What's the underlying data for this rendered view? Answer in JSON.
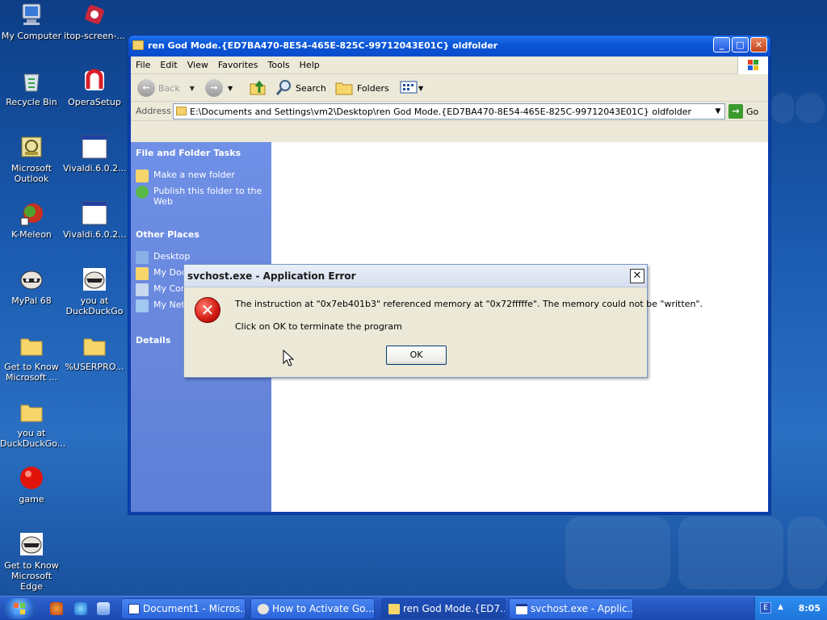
{
  "desktop": {
    "icons": [
      {
        "label": "My Computer",
        "icon": "my-computer-icon"
      },
      {
        "label": "itop-screen-...",
        "icon": "itop-app-icon"
      },
      {
        "label": "Recycle Bin",
        "icon": "recycle-bin-icon"
      },
      {
        "label": "OperaSetup",
        "icon": "opera-icon"
      },
      {
        "label": "Microsoft Outlook",
        "icon": "outlook-icon"
      },
      {
        "label": "Vivaldi.6.0.2...",
        "icon": "window-icon"
      },
      {
        "label": "K-Meleon",
        "icon": "k-meleon-icon"
      },
      {
        "label": "Vivaldi.6.0.2...",
        "icon": "window-icon"
      },
      {
        "label": "MyPal 68",
        "icon": "raccoon-icon"
      },
      {
        "label": "you at DuckDuckGo",
        "icon": "raccoon-icon"
      },
      {
        "label": "Get to Know Microsoft ...",
        "icon": "folder-icon"
      },
      {
        "label": "%USERPRO...",
        "icon": "folder-icon"
      },
      {
        "label": "you at DuckDuckGo...",
        "icon": "folder-icon"
      },
      {
        "label": "game",
        "icon": "red-ball-icon"
      },
      {
        "label": "Get to Know Microsoft Edge",
        "icon": "raccoon-icon"
      }
    ]
  },
  "explorer": {
    "title": "ren God Mode.{ED7BA470-8E54-465E-825C-99712043E01C} oldfolder",
    "menu": [
      "File",
      "Edit",
      "View",
      "Favorites",
      "Tools",
      "Help"
    ],
    "toolbar": {
      "back": "Back",
      "search": "Search",
      "folders": "Folders"
    },
    "address_label": "Address",
    "address_value": "E:\\Documents and Settings\\vm2\\Desktop\\ren God Mode.{ED7BA470-8E54-465E-825C-99712043E01C} oldfolder",
    "go_label": "Go",
    "tasks": {
      "heading": "File and Folder Tasks",
      "items": [
        "Make a new folder",
        "Publish this folder to the Web"
      ]
    },
    "other_places": {
      "heading": "Other Places",
      "items": [
        "Desktop",
        "My Documents",
        "My Computer",
        "My Network Places"
      ]
    },
    "details_heading": "Details"
  },
  "dialog": {
    "title": "svchost.exe - Application Error",
    "message": "The instruction at \"0x7eb401b3\" referenced memory at \"0x72fffffe\". The memory could not be \"written\".",
    "message2": "Click on OK to terminate the program",
    "ok_label": "OK"
  },
  "taskbar": {
    "tasks": [
      {
        "label": "Document1 - Micros...",
        "active": false
      },
      {
        "label": "How to Activate Go...",
        "active": false
      },
      {
        "label": "ren God Mode.{ED7...",
        "active": true
      },
      {
        "label": "svchost.exe - Applic...",
        "active": false
      }
    ],
    "tray_lang": "E",
    "clock": "8:05"
  }
}
